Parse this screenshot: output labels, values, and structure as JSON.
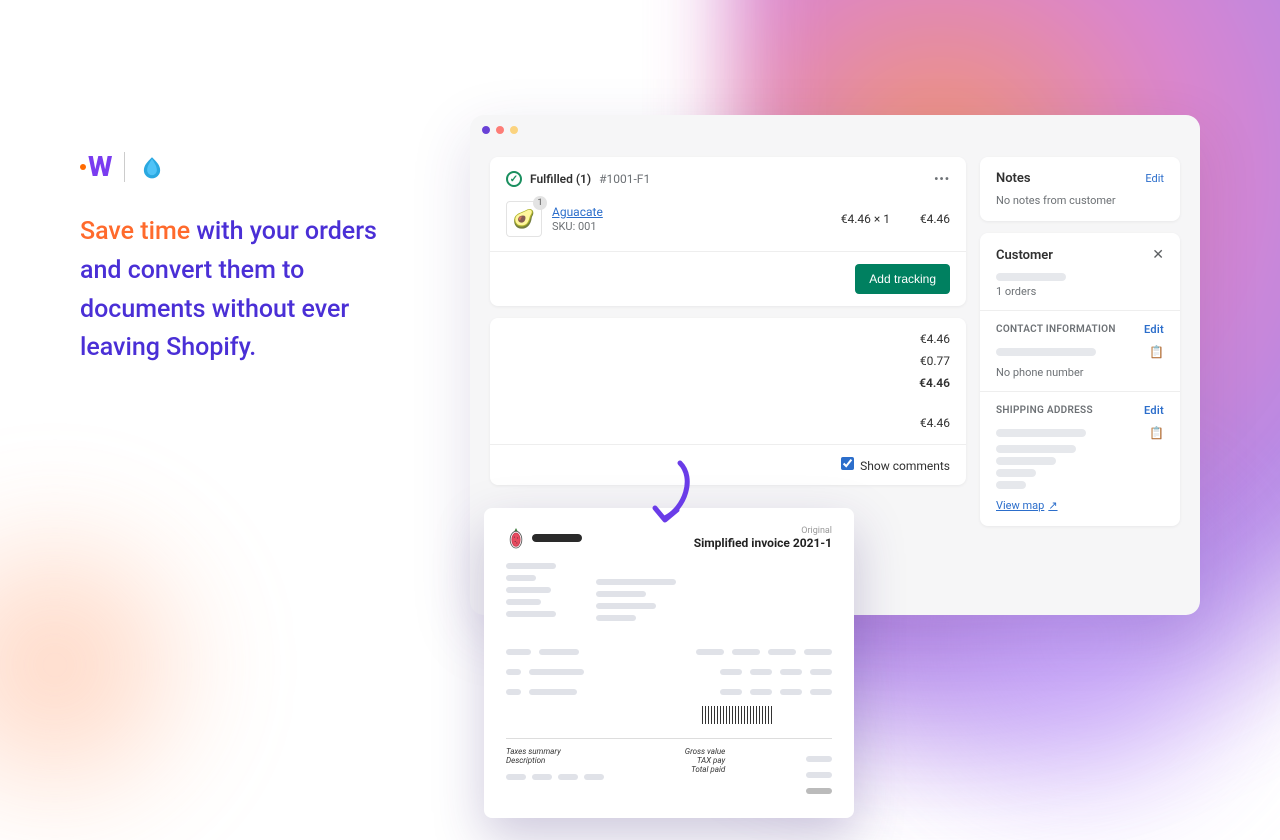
{
  "left": {
    "headline_accent": "Save time",
    "headline_rest": " with your orders and convert them to documents without ever leaving Shopify."
  },
  "fulfilled": {
    "title": "Fulfilled (1)",
    "order_id": "#1001-F1",
    "badge_qty": "1",
    "product": "Aguacate",
    "sku": "SKU: 001",
    "qty_price": "€4.46 × 1",
    "line_total": "€4.46",
    "add_tracking": "Add tracking"
  },
  "pay": {
    "r1": "€4.46",
    "r2": "€0.77",
    "r3": "€4.46",
    "r4": "€4.46",
    "show_comments": "Show comments"
  },
  "invoice": {
    "original": "Original",
    "title": "Simplified invoice 2021-1",
    "taxes": "Taxes summary",
    "desc": "Description",
    "gross": "Gross value",
    "taxpay": "TAX pay",
    "total": "Total paid"
  },
  "notes": {
    "title": "Notes",
    "edit": "Edit",
    "empty": "No notes from customer"
  },
  "customer": {
    "title": "Customer",
    "orders": "1 orders",
    "contact": "CONTACT INFORMATION",
    "edit": "Edit",
    "nophone": "No phone number",
    "shipping": "SHIPPING ADDRESS",
    "viewmap": "View map"
  }
}
